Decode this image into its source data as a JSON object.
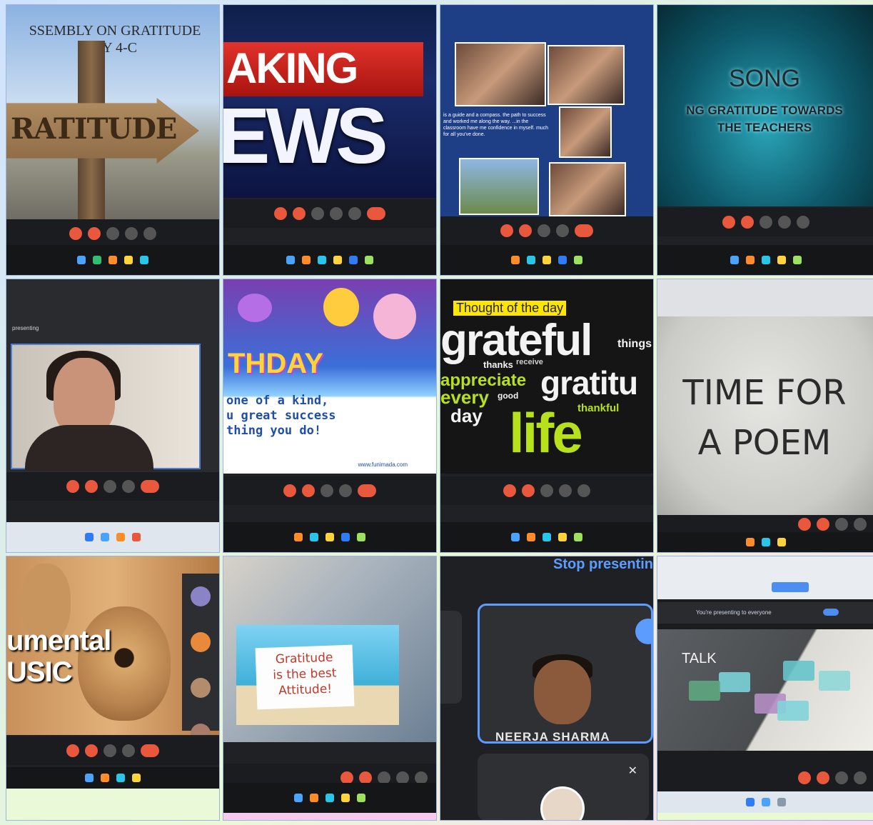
{
  "tiles": {
    "t1": {
      "title_line1": "SSEMBLY ON GRATITUDE",
      "title_line2": "BY 4-C",
      "sign": "RATITUDE"
    },
    "t2": {
      "line1": "AKING",
      "line2": "EWS"
    },
    "t3": {
      "caption": "is a guide and a compass. the path to success and worked me along the way. ...in the classroom have me confidence in myself. much for all you've done."
    },
    "t4": {
      "heading": "SONG",
      "sub1": "NG GRATITUDE TOWARDS",
      "sub2": "THE TEACHERS"
    },
    "t5": {
      "label": "presenting"
    },
    "t6": {
      "banner": "THDAY",
      "line1": "one of a kind,",
      "line2": "u great success",
      "line3": "thing you do!",
      "url": "www.funimada.com"
    },
    "t7": {
      "tag": "Thought of the day",
      "words": [
        "grateful",
        "things",
        "thanks",
        "receive",
        "appreciate",
        "gratitu",
        "every",
        "good",
        "day",
        "thankful",
        "life"
      ]
    },
    "t8": {
      "line1": "TIME FOR",
      "line2": "A POEM"
    },
    "t9": {
      "line1": "umental",
      "line2": "USIC"
    },
    "t10": {
      "line1": "Gratitude",
      "line2": "is the best",
      "line3": "Attitude!"
    },
    "t11": {
      "stop": "Stop presentin",
      "name": "NEERJA SHARMA"
    },
    "t12": {
      "banner": "You're presenting to everyone",
      "slide": "TALK"
    }
  },
  "colors": {
    "accent_blue": "#5d9cff",
    "meet_red": "#e9573d",
    "highlight_yellow": "#ffe600",
    "lime": "#b7e21b"
  }
}
